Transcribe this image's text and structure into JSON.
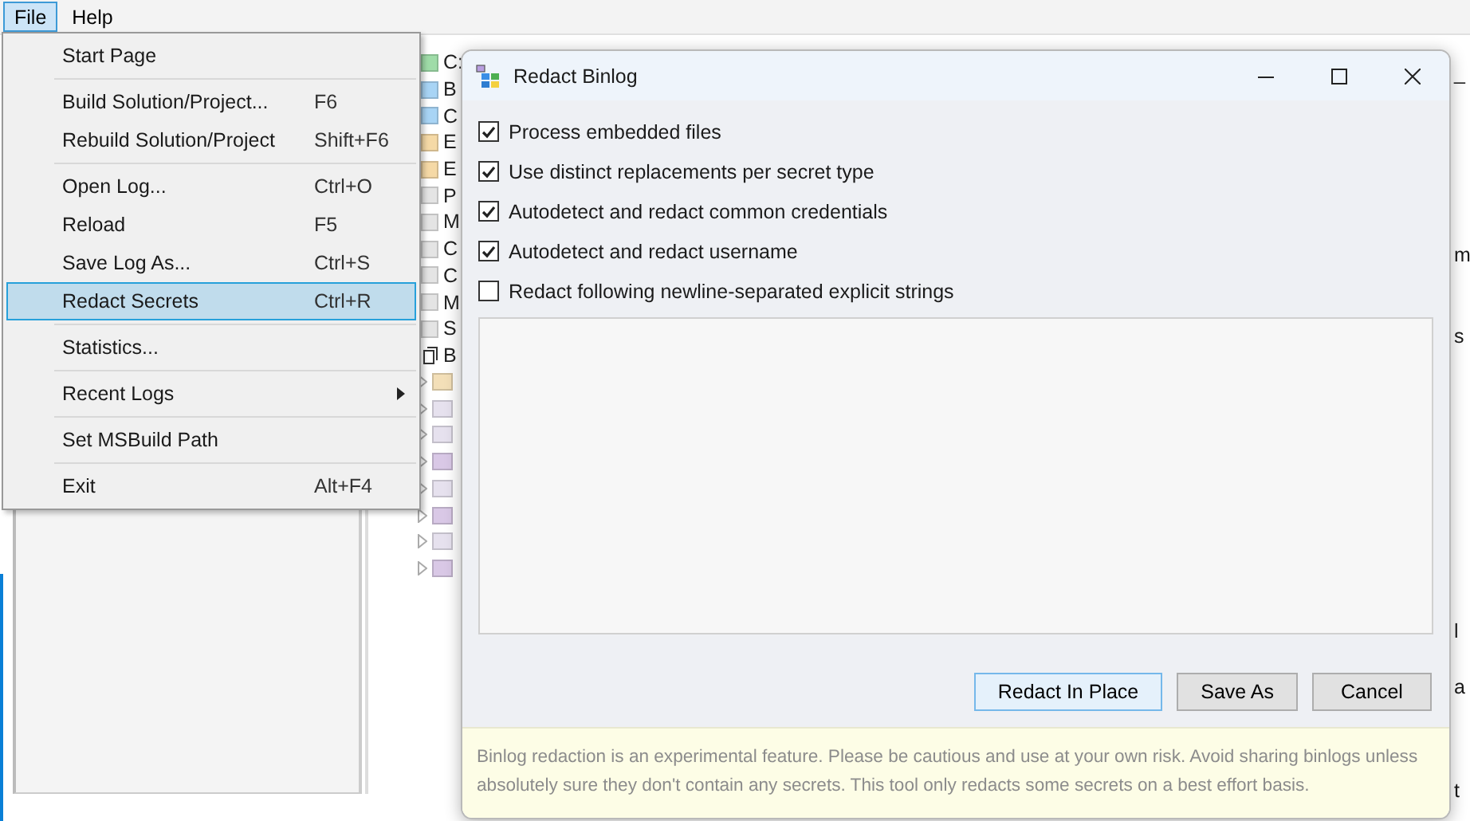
{
  "menubar": [
    {
      "label": "File",
      "selected": true
    },
    {
      "label": "Help",
      "selected": false
    }
  ],
  "menu": {
    "groups": [
      {
        "items": [
          {
            "label": "Start Page",
            "selected": false,
            "submenu": false
          }
        ]
      },
      {
        "items": [
          {
            "label": "Build Solution/Project...",
            "shortcut": "F6",
            "selected": false,
            "submenu": false
          },
          {
            "label": "Rebuild Solution/Project",
            "shortcut": "Shift+F6",
            "selected": false,
            "submenu": false
          }
        ]
      },
      {
        "items": [
          {
            "label": "Open Log...",
            "shortcut": "Ctrl+O",
            "selected": false,
            "submenu": false
          },
          {
            "label": "Reload",
            "shortcut": "F5",
            "selected": false,
            "submenu": false
          },
          {
            "label": "Save Log As...",
            "shortcut": "Ctrl+S",
            "selected": false,
            "submenu": false
          },
          {
            "label": "Redact Secrets",
            "shortcut": "Ctrl+R",
            "selected": true,
            "submenu": false
          }
        ]
      },
      {
        "items": [
          {
            "label": "Statistics...",
            "selected": false,
            "submenu": false
          }
        ]
      },
      {
        "items": [
          {
            "label": "Recent Logs",
            "selected": false,
            "submenu": true
          }
        ]
      },
      {
        "items": [
          {
            "label": "Set MSBuild Path",
            "selected": false,
            "submenu": false
          }
        ]
      },
      {
        "items": [
          {
            "label": "Exit",
            "shortcut": "Alt+F4",
            "selected": false,
            "submenu": false
          }
        ]
      }
    ]
  },
  "tree": [
    {
      "kind": "node",
      "label": "C:",
      "color": "#9fdca8"
    },
    {
      "kind": "node",
      "label": "B",
      "color": "#a8d4f5"
    },
    {
      "kind": "node",
      "label": "C",
      "color": "#a8d4f5"
    },
    {
      "kind": "node",
      "label": "E",
      "color": "#f5d9a6"
    },
    {
      "kind": "node",
      "label": "E",
      "color": "#f5d9a6"
    },
    {
      "kind": "node",
      "label": "P",
      "color": "#e4e4e4"
    },
    {
      "kind": "node",
      "label": "M",
      "color": "#e4e4e4"
    },
    {
      "kind": "node",
      "label": "C",
      "color": "#e4e4e4"
    },
    {
      "kind": "node",
      "label": "C",
      "color": "#e4e4e4"
    },
    {
      "kind": "node",
      "label": "M",
      "color": "#e4e4e4"
    },
    {
      "kind": "node",
      "label": "S",
      "color": "#e4e4e4"
    },
    {
      "kind": "file",
      "label": "B"
    },
    {
      "kind": "box",
      "color": "#f3dfb8"
    },
    {
      "kind": "box",
      "color": "#e6e1ee"
    },
    {
      "kind": "box",
      "color": "#e6e1ee"
    },
    {
      "kind": "box",
      "color": "#d9c8e6"
    },
    {
      "kind": "box",
      "color": "#e6e1ee"
    },
    {
      "kind": "box",
      "color": "#d9c8e6"
    },
    {
      "kind": "box",
      "color": "#e6e1ee"
    },
    {
      "kind": "box",
      "color": "#d9c8e6"
    }
  ],
  "right_fragments": [
    "_",
    "m",
    "s",
    "l",
    "a",
    "t"
  ],
  "dialog": {
    "title": "Redact Binlog",
    "options": [
      {
        "label": "Process embedded files",
        "checked": true
      },
      {
        "label": "Use distinct replacements per secret type",
        "checked": true
      },
      {
        "label": "Autodetect and redact common credentials",
        "checked": true
      },
      {
        "label": "Autodetect and redact username",
        "checked": true
      },
      {
        "label": "Redact following newline-separated explicit strings",
        "checked": false
      }
    ],
    "buttons": [
      {
        "label": "Redact In Place",
        "default": true
      },
      {
        "label": "Save As",
        "default": false
      },
      {
        "label": "Cancel",
        "default": false
      }
    ],
    "notice": "Binlog redaction is an experimental feature. Please be cautious and use at your own risk. Avoid sharing binlogs unless absolutely sure they don't contain any secrets. This tool only redacts some secrets on a best effort basis."
  }
}
